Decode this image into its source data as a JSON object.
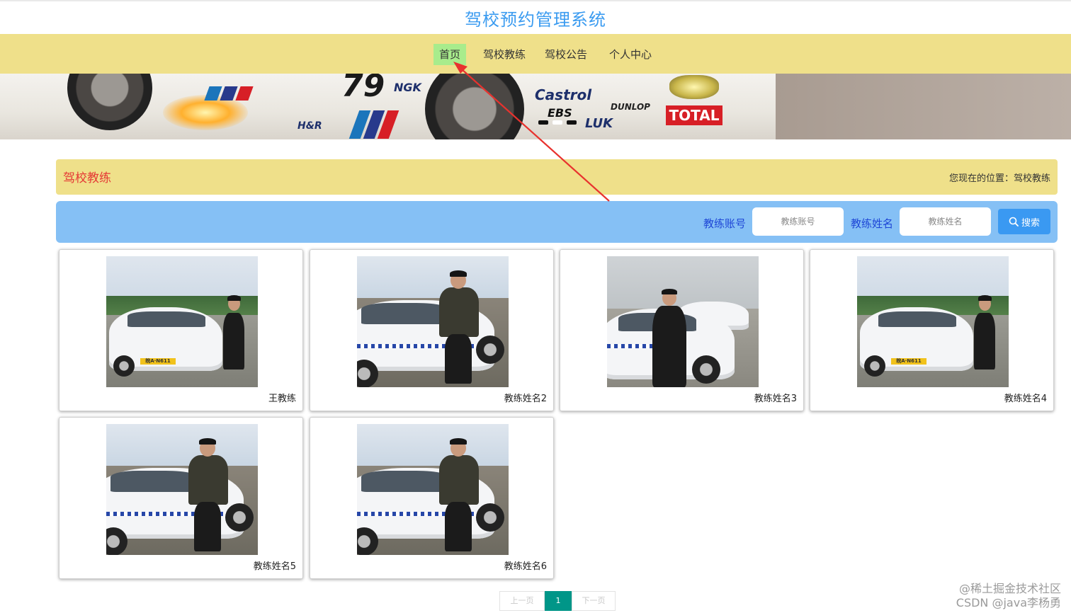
{
  "site": {
    "title": "驾校预约管理系统"
  },
  "nav": {
    "items": [
      {
        "label": "首页",
        "active": true
      },
      {
        "label": "驾校教练",
        "active": false
      },
      {
        "label": "驾校公告",
        "active": false
      },
      {
        "label": "个人中心",
        "active": false
      }
    ]
  },
  "banner": {
    "sponsors": [
      "Castrol",
      "DUNLOP",
      "TOTAL",
      "EBS",
      "LUK",
      "NGK",
      "H&R"
    ],
    "car_number": "79",
    "carousel_dots": 3,
    "active_dot": 1
  },
  "breadcrumb": {
    "title": "驾校教练",
    "location": "您现在的位置：驾校教练"
  },
  "search": {
    "account_label": "教练账号",
    "account_placeholder": "教练账号",
    "name_label": "教练姓名",
    "name_placeholder": "教练姓名",
    "button_label": "搜索"
  },
  "cards": [
    {
      "name": "王教练",
      "photo": "coach-with-white-car-front"
    },
    {
      "name": "教练姓名2",
      "photo": "coach-leaning-on-car-side"
    },
    {
      "name": "教练姓名3",
      "photo": "coach-with-row-of-cars"
    },
    {
      "name": "教练姓名4",
      "photo": "coach-with-white-car-front"
    },
    {
      "name": "教练姓名5",
      "photo": "coach-leaning-on-car-side"
    },
    {
      "name": "教练姓名6",
      "photo": "coach-leaning-on-car-side"
    }
  ],
  "pagination": {
    "prev_label": "上一页",
    "current": "1",
    "next_label": "下一页"
  },
  "watermark": {
    "line1": "@稀土掘金技术社区",
    "line2": "CSDN @java李杨勇"
  },
  "colors": {
    "title_blue": "#3a9bf0",
    "nav_bg": "#efe08a",
    "active_nav": "#a8ec8c",
    "search_bar": "#85c0f5",
    "search_button": "#3a99f2",
    "pager_current": "#009688",
    "crumb_title": "#e53935",
    "annotation_arrow": "#e8322e"
  }
}
